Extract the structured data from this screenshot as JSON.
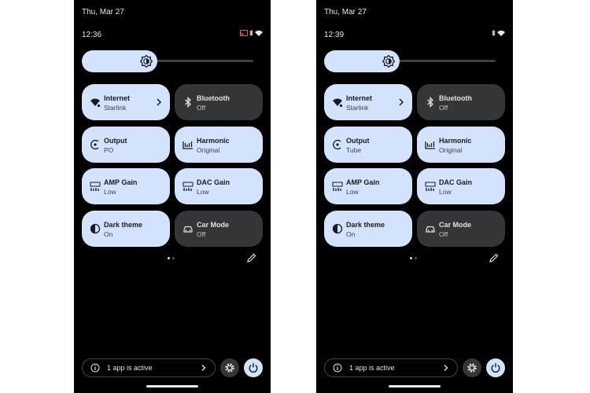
{
  "colors": {
    "tile_on": "#d3e3fd",
    "tile_off": "#333537",
    "background": "#000000"
  },
  "screens": [
    {
      "date": "Thu, Mar 27",
      "time": "12:36",
      "tiles": [
        {
          "title": "Internet",
          "subtitle": "Starlink",
          "icon": "wifi-icon",
          "state": "on"
        },
        {
          "title": "Bluetooth",
          "subtitle": "Off",
          "icon": "bluetooth-icon",
          "state": "off"
        },
        {
          "title": "Output",
          "subtitle": "PO",
          "icon": "output-icon",
          "state": "on"
        },
        {
          "title": "Harmonic",
          "subtitle": "Original",
          "icon": "harmonic-icon",
          "state": "on"
        },
        {
          "title": "AMP Gain",
          "subtitle": "Low",
          "icon": "amp-gain-icon",
          "state": "on"
        },
        {
          "title": "DAC Gain",
          "subtitle": "Low",
          "icon": "dac-gain-icon",
          "state": "on"
        },
        {
          "title": "Dark theme",
          "subtitle": "On",
          "icon": "dark-theme-icon",
          "state": "on"
        },
        {
          "title": "Car Mode",
          "subtitle": "Off",
          "icon": "car-icon",
          "state": "off"
        }
      ],
      "active_apps": "1 app is active"
    },
    {
      "date": "Thu, Mar 27",
      "time": "12:39",
      "tiles": [
        {
          "title": "Internet",
          "subtitle": "Starlink",
          "icon": "wifi-icon",
          "state": "on"
        },
        {
          "title": "Bluetooth",
          "subtitle": "Off",
          "icon": "bluetooth-icon",
          "state": "off"
        },
        {
          "title": "Output",
          "subtitle": "Tube",
          "icon": "output-icon",
          "state": "on"
        },
        {
          "title": "Harmonic",
          "subtitle": "Original",
          "icon": "harmonic-icon",
          "state": "on"
        },
        {
          "title": "AMP Gain",
          "subtitle": "Low",
          "icon": "amp-gain-icon",
          "state": "on"
        },
        {
          "title": "DAC Gain",
          "subtitle": "Low",
          "icon": "dac-gain-icon",
          "state": "on"
        },
        {
          "title": "Dark theme",
          "subtitle": "On",
          "icon": "dark-theme-icon",
          "state": "on"
        },
        {
          "title": "Car Mode",
          "subtitle": "Off",
          "icon": "car-icon",
          "state": "off"
        }
      ],
      "active_apps": "1 app is active"
    }
  ]
}
